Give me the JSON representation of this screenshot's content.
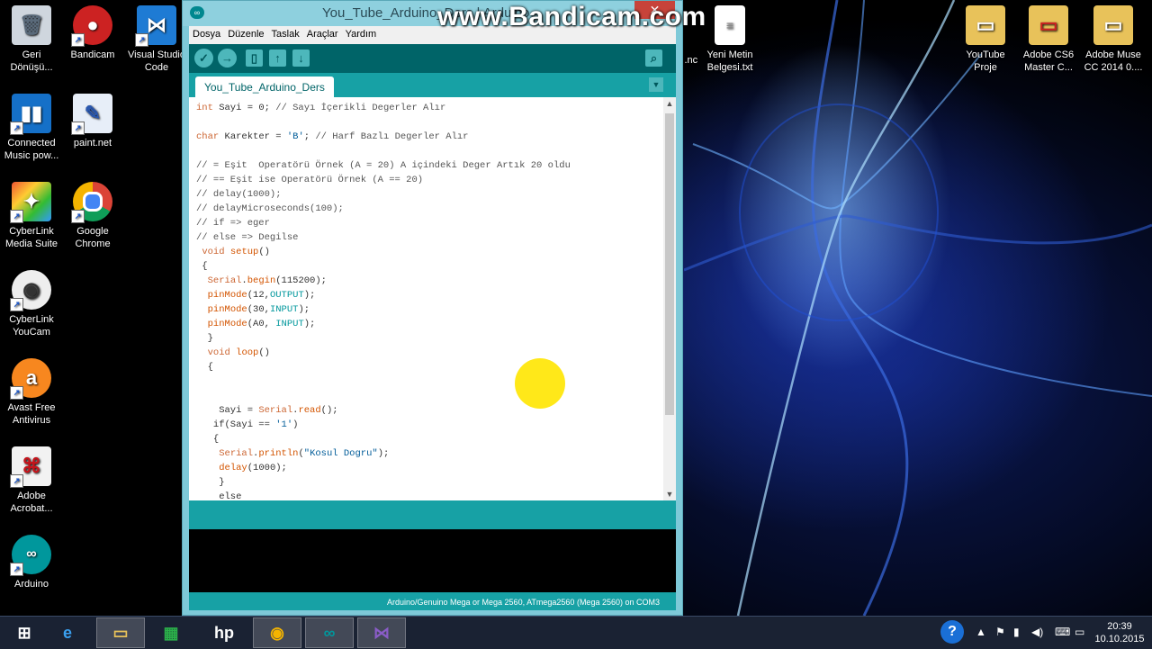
{
  "watermark": "www.Bandicam.com",
  "desktop": {
    "left_icons": [
      {
        "label": "Geri Dönüşü...",
        "icon": "recycle-bin-icon"
      },
      {
        "label": "Bandicam",
        "icon": "bandicam-icon"
      },
      {
        "label": "Visual Studio Code",
        "icon": "vscode-icon"
      },
      {
        "label": "Connected Music pow...",
        "icon": "connected-music-icon"
      },
      {
        "label": "paint.net",
        "icon": "paintnet-icon"
      },
      {
        "label": "CyberLink Media Suite",
        "icon": "cyberlink-media-suite-icon"
      },
      {
        "label": "Google Chrome",
        "icon": "chrome-icon"
      },
      {
        "label": "CyberLink YouCam",
        "icon": "youcam-icon"
      },
      {
        "label": "Avast Free Antivirus",
        "icon": "avast-icon"
      },
      {
        "label": "Adobe Acrobat...",
        "icon": "acrobat-icon"
      },
      {
        "label": "Arduino",
        "icon": "arduino-icon"
      }
    ],
    "right_icons": [
      {
        "label": "in .nc",
        "icon": "file-icon"
      },
      {
        "label": "Yeni Metin Belgesi.txt",
        "icon": "text-file-icon"
      },
      {
        "label": "YouTube Proje",
        "icon": "folder-icon"
      },
      {
        "label": "Adobe CS6 Master C...",
        "icon": "folder-icon"
      },
      {
        "label": "Adobe Muse CC 2014 0....",
        "icon": "folder-icon"
      }
    ]
  },
  "window": {
    "title": "You_Tube_Arduino_Ders | Arduino",
    "close_label": "✕",
    "menu": [
      "Dosya",
      "Düzenle",
      "Taslak",
      "Araçlar",
      "Yardım"
    ],
    "tab": "You_Tube_Arduino_Ders",
    "board_status": "Arduino/Genuino Mega or Mega 2560, ATmega2560 (Mega 2560) on COM3"
  },
  "code_lines": [
    "int Sayi = 0; // Sayı İçerikli Degerler Alır",
    "",
    "char Karekter = 'B'; // Harf Bazlı Degerler Alır",
    "",
    "// = Eşit  Operatörü Örnek (A = 20) A içindeki Deger Artık 20 oldu",
    "// == Eşit ise Operatörü Örnek (A == 20)",
    "// delay(1000);",
    "// delayMicroseconds(100);",
    "// if => eger",
    "// else => Degilse",
    " void setup()",
    " {",
    "  Serial.begin(115200);",
    "  pinMode(12,OUTPUT);",
    "  pinMode(30,INPUT);",
    "  pinMode(A0, INPUT);",
    "  }",
    "  void loop()",
    "  {",
    "",
    "",
    "    Sayi = Serial.read();",
    "   if(Sayi == '1')",
    "   {",
    "    Serial.println(\"Kosul Dogru\");",
    "    delay(1000);",
    "    }",
    "    else",
    "    {"
  ],
  "taskbar": {
    "apps": [
      "windows-start-icon",
      "internet-explorer-icon",
      "file-explorer-icon",
      "store-icon",
      "hp-icon",
      "chrome-icon",
      "arduino-icon",
      "visual-studio-icon"
    ],
    "time": "20:39",
    "date": "10.10.2015"
  },
  "colors": {
    "arduino_teal": "#00979c",
    "arduino_dark": "#006468",
    "highlight": "#ffe600"
  }
}
